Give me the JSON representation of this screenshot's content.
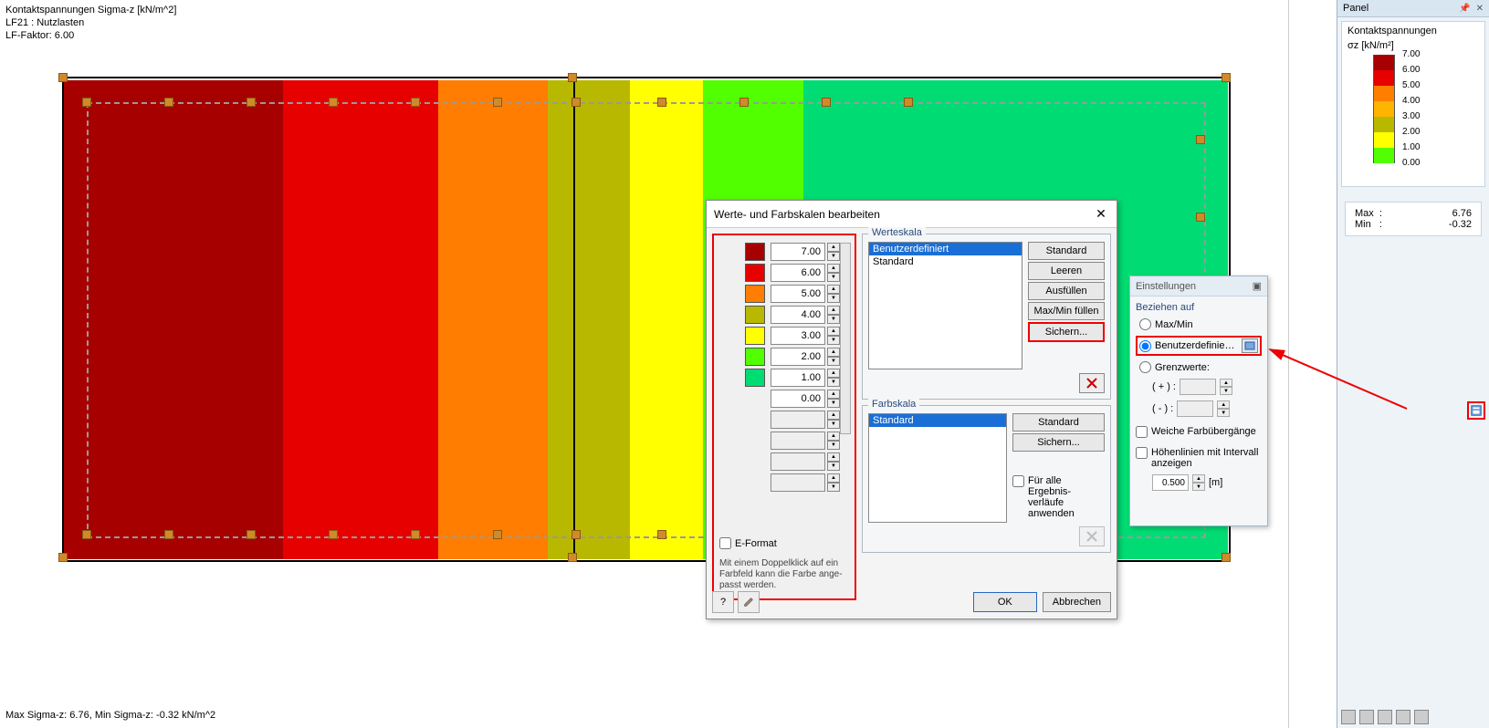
{
  "viewport": {
    "info_line1": "Kontaktspannungen Sigma-z [kN/m^2]",
    "info_line2": "LF21 : Nutzlasten",
    "info_line3": "LF-Faktor: 6.00",
    "footer": "Max Sigma-z: 6.76, Min Sigma-z: -0.32 kN/m^2"
  },
  "panel": {
    "title": "Panel",
    "legend_title1": "Kontaktspannungen",
    "legend_title2": "σz [kN/m²]",
    "values": [
      "7.00",
      "6.00",
      "5.00",
      "4.00",
      "3.00",
      "2.00",
      "1.00",
      "0.00"
    ],
    "colors": [
      "#a60000",
      "#e60000",
      "#ff7d00",
      "#ffb400",
      "#b9b800",
      "#ffff00",
      "#52ff00",
      "#00dc73"
    ],
    "max_label": "Max",
    "max_val": "6.76",
    "min_label": "Min",
    "min_val": "-0.32"
  },
  "dialog": {
    "title": "Werte- und Farbskalen bearbeiten",
    "values": [
      "7.00",
      "6.00",
      "5.00",
      "4.00",
      "3.00",
      "2.00",
      "1.00",
      "0.00"
    ],
    "colors": [
      "#a60000",
      "#e60000",
      "#ff7d00",
      "#b9b800",
      "#ffff00",
      "#52ff00",
      "#00dc73"
    ],
    "eformat_label": "E-Format",
    "helptext": "Mit einem Doppelklick auf ein Farbfeld kann die Farbe ange-passt werden.",
    "werteskala_title": "Werteskala",
    "werteskala_items": [
      "Benutzerdefiniert",
      "Standard"
    ],
    "btn_standard": "Standard",
    "btn_leeren": "Leeren",
    "btn_ausfuellen": "Ausfüllen",
    "btn_maxmin": "Max/Min füllen",
    "btn_sichern": "Sichern...",
    "farbskala_title": "Farbskala",
    "farbskala_items": [
      "Standard"
    ],
    "fb_standard": "Standard",
    "fb_sichern": "Sichern...",
    "fb_check": "Für alle Ergebnis-verläufe anwenden",
    "ok": "OK",
    "cancel": "Abbrechen"
  },
  "popover": {
    "title": "Einstellungen",
    "group1": "Beziehen auf",
    "r1": "Max/Min",
    "r2": "Benutzerdefinierte...",
    "r3": "Grenzwerte:",
    "plus": "( + ) :",
    "minus": "( - ) :",
    "smooth": "Weiche Farbübergänge",
    "contour": "Höhenlinien mit Intervall anzeigen",
    "interval_val": "0.500",
    "interval_unit": "[m]"
  },
  "chart_data": {
    "type": "contour-legend",
    "title": "Kontaktspannungen σz [kN/m²]",
    "unit": "kN/m²",
    "levels": [
      7.0,
      6.0,
      5.0,
      4.0,
      3.0,
      2.0,
      1.0,
      0.0
    ],
    "colors": [
      "#a60000",
      "#e60000",
      "#ff7d00",
      "#ffb400",
      "#b9b800",
      "#ffff00",
      "#52ff00",
      "#00dc73"
    ],
    "max": 6.76,
    "min": -0.32
  }
}
